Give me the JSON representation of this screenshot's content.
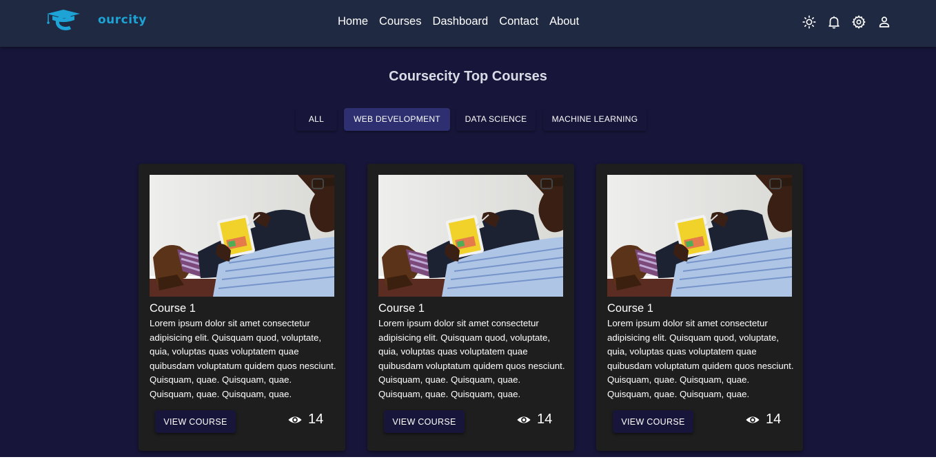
{
  "header": {
    "logo_text": "ourcity",
    "nav": [
      "Home",
      "Courses",
      "Dashboard",
      "Contact",
      "About"
    ],
    "icons": [
      "sun-icon",
      "bell-icon",
      "gear-icon",
      "user-icon"
    ]
  },
  "title": "Coursecity Top Courses",
  "tabs": [
    {
      "label": "ALL",
      "active": false
    },
    {
      "label": "WEB DEVELOPMENT",
      "active": true
    },
    {
      "label": "DATA SCIENCE",
      "active": false
    },
    {
      "label": "MACHINE LEARNING",
      "active": false
    }
  ],
  "courses": [
    {
      "title": "Course 1",
      "description": "Lorem ipsum dolor sit amet consectetur adipisicing elit. Quisquam quod, voluptate, quia, voluptas quas voluptatem quae quibusdam voluptatum quidem quos nesciunt. Quisquam, quae. Quisquam, quae. Quisquam, quae. Quisquam, quae.",
      "button": "VIEW COURSE",
      "views": "14"
    },
    {
      "title": "Course 1",
      "description": "Lorem ipsum dolor sit amet consectetur adipisicing elit. Quisquam quod, voluptate, quia, voluptas quas voluptatem quae quibusdam voluptatum quidem quos nesciunt. Quisquam, quae. Quisquam, quae. Quisquam, quae. Quisquam, quae.",
      "button": "VIEW COURSE",
      "views": "14"
    },
    {
      "title": "Course 1",
      "description": "Lorem ipsum dolor sit amet consectetur adipisicing elit. Quisquam quod, voluptate, quia, voluptas quas voluptatem quae quibusdam voluptatum quidem quos nesciunt. Quisquam, quae. Quisquam, quae. Quisquam, quae. Quisquam, quae.",
      "button": "VIEW COURSE",
      "views": "14"
    }
  ],
  "colors": {
    "background": "#17163a",
    "header": "#1f2942",
    "card": "#1e1e1e",
    "active_tab": "#2e2f70",
    "brand": "#1ea3d6"
  }
}
